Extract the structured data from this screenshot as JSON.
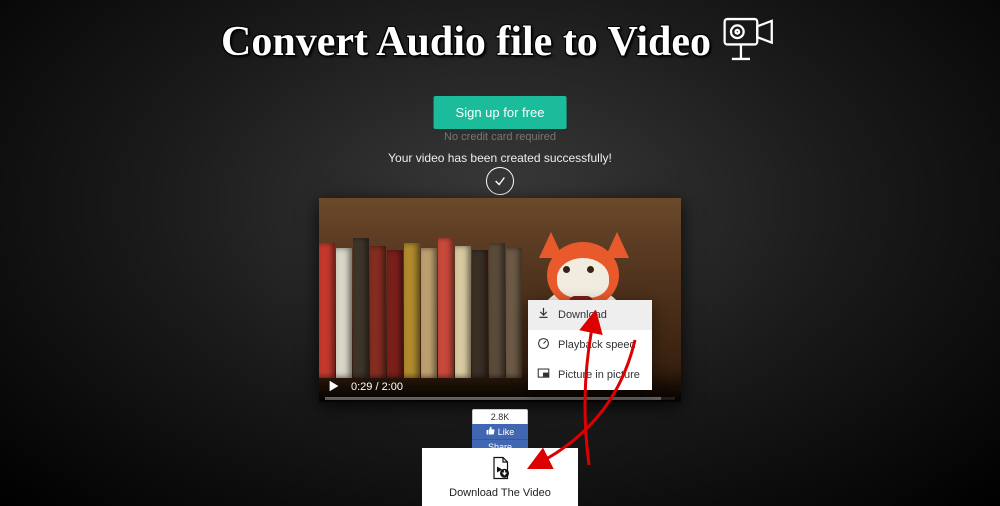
{
  "header": {
    "title": "Convert Audio file to Video"
  },
  "cta": {
    "signup_label": "Sign up for free",
    "no_cc": "No credit card required"
  },
  "status": {
    "success": "Your video has been created successfully!"
  },
  "player": {
    "current_time": "0:29",
    "sep": " / ",
    "duration": "2:00"
  },
  "context_menu": {
    "download": "Download",
    "playback": "Playback speed",
    "pip": "Picture in picture"
  },
  "facebook": {
    "count": "2.8K",
    "like": "Like",
    "share": "Share"
  },
  "download_card": {
    "label": "Download The Video"
  }
}
